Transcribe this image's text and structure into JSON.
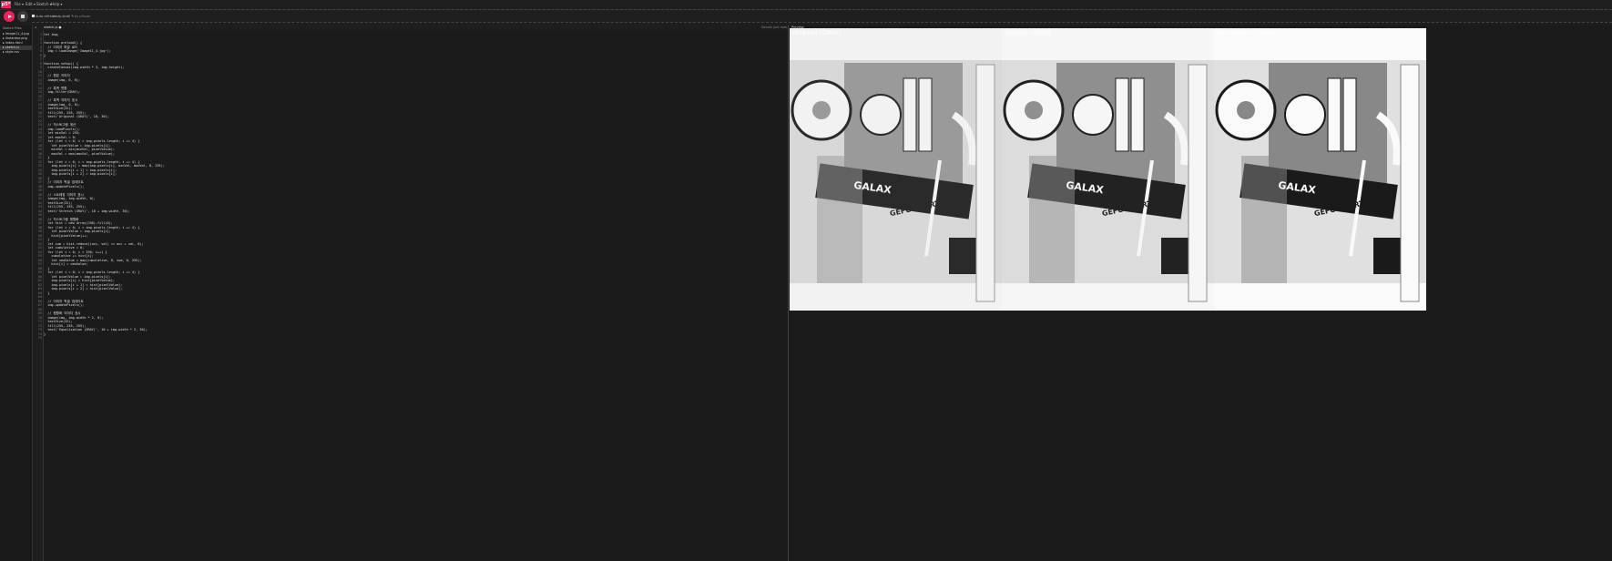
{
  "app": {
    "logo": "p5*"
  },
  "menu": [
    "File ▾",
    "Edit ▾",
    "Sketch ▾",
    "Help ▾"
  ],
  "toolbar": {
    "auto_refresh": "Auto-refresh",
    "sketch_name": "zesty-lentil ✎",
    "by": "by p5user"
  },
  "sidebar": {
    "header": "Sketch Files",
    "files": [
      "Image11_4.jpg",
      "lineartwo.png",
      "index.html",
      "sketch.js",
      "style.css"
    ],
    "selected": 3
  },
  "editor": {
    "tab": "sketch.js ●",
    "saved": "Saved: just now",
    "highlight_line": 73,
    "lines": [
      "let img;",
      "",
      "function preload() {",
      "  // 이미지 파일 로드",
      "  img = loadImage('Image11_4.jpg');",
      "}",
      "",
      "function setup() {",
      "  createCanvas(img.width * 3, img.height);",
      "",
      "  // 원본 이미지",
      "  image(img, 0, 0);",
      "",
      "  // 흑백 변환",
      "  img.filter(GRAY);",
      "",
      "  // 흑백 이미지 표시",
      "  image(img, 0, 0);",
      "  textSize(32);",
      "  fill(255, 255, 255);",
      "  text('Original (GRAY)', 10, 30);",
      "",
      "  // 히스토그램 계산",
      "  img.loadPixels();",
      "  let minVal = 255;",
      "  let maxVal = 0;",
      "  for (let i = 0; i < img.pixels.length; i += 4) {",
      "    let pixelValue = img.pixels[i];",
      "    minVal = min(minVal, pixelValue);",
      "    maxVal = max(maxVal, pixelValue);",
      "  }",
      "  for (let i = 0; i < img.pixels.length; i += 4) {",
      "    img.pixels[i] = map(img.pixels[i], minVal, maxVal, 0, 255);",
      "    img.pixels[i + 1] = img.pixels[i];",
      "    img.pixels[i + 2] = img.pixels[i];",
      "  }",
      "  // 이미지 픽셀 업데이트",
      "  img.updatePixels();",
      "",
      "  // 스트레칭 이미지 표시",
      "  image(img, img.width, 0);",
      "  textSize(32);",
      "  fill(255, 255, 255);",
      "  text('Stretch (GRAY)', 10 + img.width, 30);",
      "",
      "  // 히스토그램 평활화",
      "  let hist = new Array(256).fill(0);",
      "  for (let i = 0; i < img.pixels.length; i += 4) {",
      "    let pixelValue = img.pixels[i];",
      "    hist[pixelValue]++;",
      "  }",
      "  let sum = hist.reduce((acc, val) => acc + val, 0);",
      "  let cumulative = 0;",
      "  for (let i = 0; i < 256; i++) {",
      "    cumulative += hist[i];",
      "    let newValue = map(cumulative, 0, sum, 0, 255);",
      "    hist[i] = newValue;",
      "  }",
      "  for (let i = 0; i < img.pixels.length; i += 4) {",
      "    let pixelValue = img.pixels[i];",
      "    img.pixels[i] = hist[pixelValue];",
      "    img.pixels[i + 1] = hist[pixelValue];",
      "    img.pixels[i + 2] = hist[pixelValue];",
      "  }",
      "",
      "  // 이미지 픽셀 업데이트",
      "  img.updatePixels();",
      "",
      "  // 평활화 이미지 표시",
      "  image(img, img.width * 2, 0);",
      "  textSize(32);",
      "  fill(255, 255, 255);",
      "  text('Equalization (GRAY)', 10 + img.width * 2, 30);",
      "}",
      ""
    ]
  },
  "preview": {
    "header": "Preview",
    "labels": [
      "Original (GRAY)",
      "Stretch (GRAY)",
      "Equalization (GRAY)"
    ],
    "logo_text": "GALAX",
    "gpu_text": "GEFORCE RTX"
  }
}
